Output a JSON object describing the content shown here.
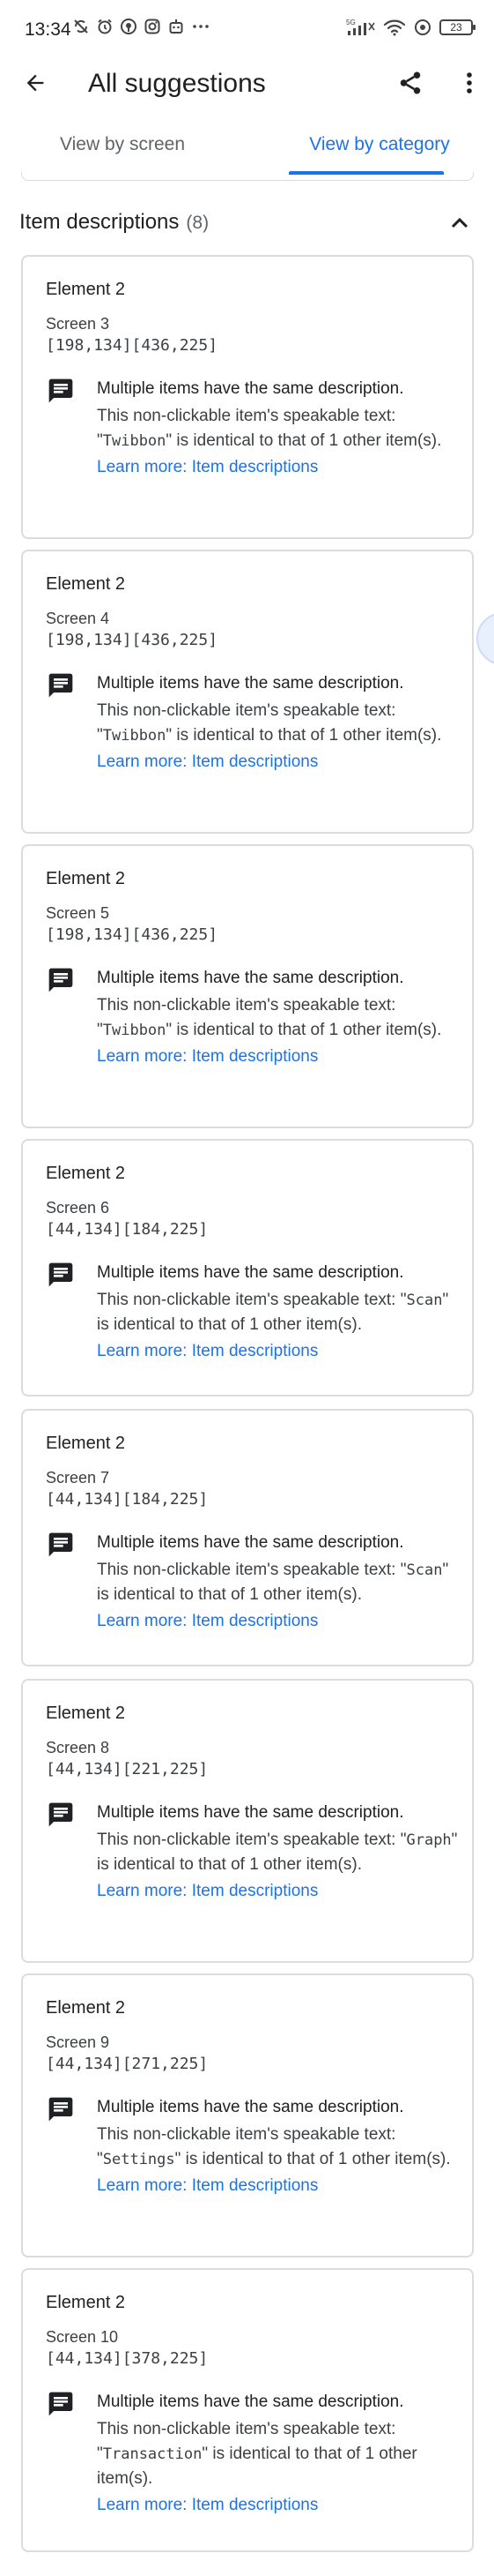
{
  "status_bar": {
    "time": "13:34",
    "network_label": "5G",
    "battery": "23"
  },
  "app_bar": {
    "title": "All suggestions"
  },
  "tabs": [
    {
      "label": "View by screen",
      "selected": false
    },
    {
      "label": "View by category",
      "selected": true
    }
  ],
  "section": {
    "title": "Item descriptions",
    "count": "(8)"
  },
  "cards": [
    {
      "element": "Element 2",
      "screen": "Screen 3",
      "bounds": "[198,134][436,225]",
      "summary": "Multiple items have the same description.",
      "detail_pre": "This non-clickable item's speakable text: \"",
      "detail_code": "Twibbon",
      "detail_post": "\" is identical to that of 1 other item(s).",
      "link": "Learn more: Item descriptions"
    },
    {
      "element": "Element 2",
      "screen": "Screen 4",
      "bounds": "[198,134][436,225]",
      "summary": "Multiple items have the same description.",
      "detail_pre": "This non-clickable item's speakable text: \"",
      "detail_code": "Twibbon",
      "detail_post": "\" is identical to that of 1 other item(s).",
      "link": "Learn more: Item descriptions"
    },
    {
      "element": "Element 2",
      "screen": "Screen 5",
      "bounds": "[198,134][436,225]",
      "summary": "Multiple items have the same description.",
      "detail_pre": "This non-clickable item's speakable text: \"",
      "detail_code": "Twibbon",
      "detail_post": "\" is identical to that of 1 other item(s).",
      "link": "Learn more: Item descriptions"
    },
    {
      "element": "Element 2",
      "screen": "Screen 6",
      "bounds": "[44,134][184,225]",
      "summary": "Multiple items have the same description.",
      "detail_pre": "This non-clickable item's speakable text: \"",
      "detail_code": "Scan",
      "detail_post": "\" is identical to that of 1 other item(s).",
      "link": "Learn more: Item descriptions"
    },
    {
      "element": "Element 2",
      "screen": "Screen 7",
      "bounds": "[44,134][184,225]",
      "summary": "Multiple items have the same description.",
      "detail_pre": "This non-clickable item's speakable text: \"",
      "detail_code": "Scan",
      "detail_post": "\" is identical to that of 1 other item(s).",
      "link": "Learn more: Item descriptions"
    },
    {
      "element": "Element 2",
      "screen": "Screen 8",
      "bounds": "[44,134][221,225]",
      "summary": "Multiple items have the same description.",
      "detail_pre": "This non-clickable item's speakable text: \"",
      "detail_code": "Graph",
      "detail_post": "\" is identical to that of 1 other item(s).",
      "link": "Learn more: Item descriptions"
    },
    {
      "element": "Element 2",
      "screen": "Screen 9",
      "bounds": "[44,134][271,225]",
      "summary": "Multiple items have the same description.",
      "detail_pre": "This non-clickable item's speakable text: \"",
      "detail_code": "Settings",
      "detail_post": "\" is identical to that of 1 other item(s).",
      "link": "Learn more: Item descriptions"
    },
    {
      "element": "Element 2",
      "screen": "Screen 10",
      "bounds": "[44,134][378,225]",
      "summary": "Multiple items have the same description.",
      "detail_pre": "This non-clickable item's speakable text: \"",
      "detail_code": "Transaction",
      "detail_post": "\" is identical to that of 1 other item(s).",
      "link": "Learn more: Item descriptions"
    }
  ],
  "colors": {
    "accent": "#1a73e8",
    "border": "#dadce0",
    "text_primary": "#202124",
    "text_secondary": "#5f6368"
  }
}
